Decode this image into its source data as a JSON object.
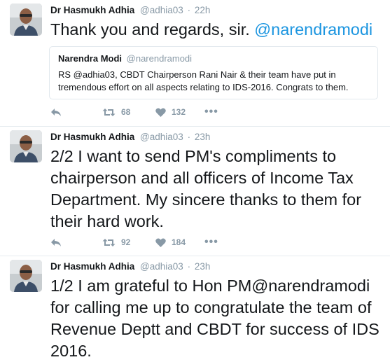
{
  "tweets": [
    {
      "author": "Dr Hasmukh Adhia",
      "handle": "@adhia03",
      "separator": "·",
      "time": "22h",
      "text_parts": [
        "Thank you and regards, sir. ",
        "@narendramodi"
      ],
      "quoted": {
        "author": "Narendra Modi",
        "handle": "@narendramodi",
        "text": "RS @adhia03, CBDT Chairperson Rani Nair & their team have put in tremendous effort on all aspects relating to IDS-2016. Congrats to them."
      },
      "retweets": "68",
      "likes": "132",
      "more": "•••"
    },
    {
      "author": "Dr Hasmukh Adhia",
      "handle": "@adhia03",
      "separator": "·",
      "time": "23h",
      "text_parts": [
        "2/2 I want to send PM's compliments to chairperson and all officers of Income Tax Department. My sincere thanks to them for their hard work."
      ],
      "retweets": "92",
      "likes": "184",
      "more": "•••"
    },
    {
      "author": "Dr Hasmukh Adhia",
      "handle": "@adhia03",
      "separator": "·",
      "time": "23h",
      "text_parts": [
        "1/2 I am grateful to Hon PM@narendramodi for calling me up to congratulate the team of Revenue Deptt and CBDT for success of IDS 2016."
      ]
    }
  ],
  "icons": {
    "reply": "reply-icon",
    "retweet": "retweet-icon",
    "like": "heart-icon",
    "more": "more-icon"
  },
  "colors": {
    "link": "#1b95e0",
    "muted": "#8899a6",
    "divider": "#e6ecf0"
  }
}
